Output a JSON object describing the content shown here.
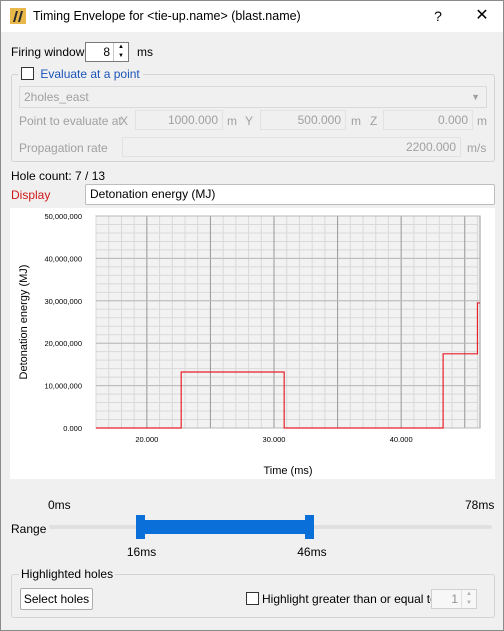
{
  "window": {
    "title": "Timing Envelope for <tie-up.name> (blast.name)",
    "help_label": "?",
    "close_label": "✕"
  },
  "firing_window": {
    "label": "Firing window",
    "value": "8",
    "unit": "ms"
  },
  "evaluate": {
    "checkbox_label": "Evaluate at a point",
    "checked": false,
    "combo_value": "2holes_east",
    "point_label": "Point to evaluate at",
    "x_label": "X",
    "x_value": "1000.000",
    "x_unit": "m",
    "y_label": "Y",
    "y_value": "500.000",
    "y_unit": "m",
    "z_label": "Z",
    "z_value": "0.000",
    "z_unit": "m",
    "rate_label": "Propagation rate",
    "rate_value": "2200.000",
    "rate_unit": "m/s"
  },
  "hole_count": "Hole count: 7 / 13",
  "display": {
    "label": "Display",
    "value": "Detonation energy (MJ)"
  },
  "chart_data": {
    "type": "line",
    "xlabel": "Time (ms)",
    "ylabel": "Detonation energy (MJ)",
    "xlim": [
      16,
      46.2
    ],
    "ylim": [
      0,
      50000000
    ],
    "x_ticks": [
      20,
      30,
      40
    ],
    "x_tick_labels": [
      "20.000",
      "30.000",
      "40.000"
    ],
    "y_ticks": [
      0,
      10000000,
      20000000,
      30000000,
      40000000,
      50000000
    ],
    "y_tick_labels": [
      "0.000",
      "10,000,000",
      "20,000,000",
      "30,000,000",
      "40,000,000",
      "50,000,000"
    ],
    "grid": true,
    "line_color": "#e8202a",
    "x": [
      16,
      22.7,
      22.7,
      30.8,
      30.8,
      43.3,
      43.3,
      46,
      46,
      46.2
    ],
    "y": [
      0,
      0,
      13200000,
      13200000,
      0,
      0,
      17500000,
      17500000,
      29500000,
      29500000
    ]
  },
  "range": {
    "label": "Range",
    "min_label": "0ms",
    "max_label": "78ms",
    "low_label": "16ms",
    "high_label": "46ms",
    "min": 0,
    "max": 78,
    "low": 16,
    "high": 46,
    "accent": "#0a6fd8"
  },
  "highlighted": {
    "group_label": "Highlighted holes",
    "select_button": "Select holes",
    "checkbox_label": "Highlight greater than or equal to",
    "threshold": "1"
  }
}
